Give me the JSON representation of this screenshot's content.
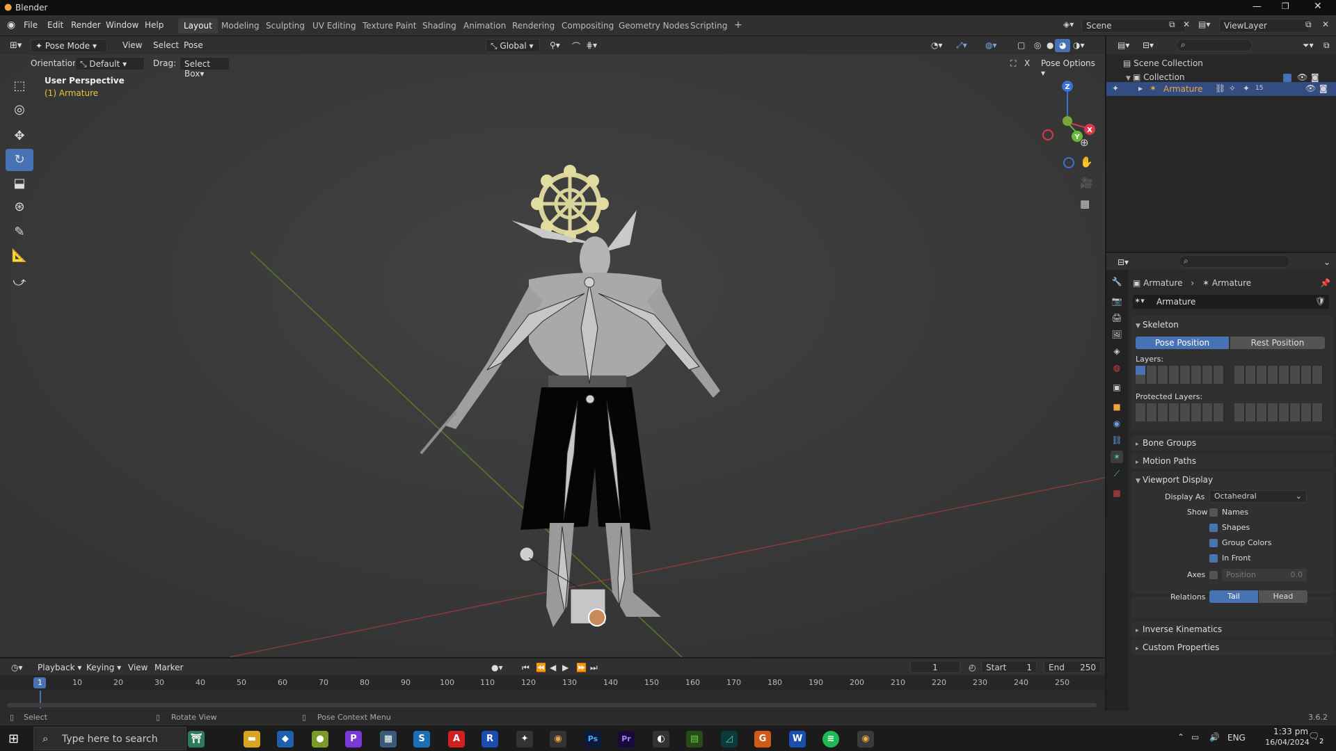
{
  "window": {
    "title": "Blender",
    "version": "3.6.2"
  },
  "menu": {
    "file": "File",
    "edit": "Edit",
    "render": "Render",
    "window": "Window",
    "help": "Help"
  },
  "workspaces": [
    "Layout",
    "Modeling",
    "Sculpting",
    "UV Editing",
    "Texture Paint",
    "Shading",
    "Animation",
    "Rendering",
    "Compositing",
    "Geometry Nodes",
    "Scripting"
  ],
  "active_workspace": "Layout",
  "scene": {
    "name": "Scene",
    "view_layer": "ViewLayer"
  },
  "viewport": {
    "mode": "Pose Mode",
    "menus": {
      "view": "View",
      "select": "Select",
      "pose": "Pose"
    },
    "transform_orientation": "Global",
    "orientation_label": "Orientation:",
    "orientation_value": "Default",
    "drag_label": "Drag:",
    "drag_value": "Select Box",
    "pose_options": "Pose Options",
    "overlay_title": "User Perspective",
    "overlay_object": "(1) Armature",
    "gizmo_axes": {
      "x": "X",
      "y": "Y",
      "z": "Z"
    }
  },
  "outliner": {
    "scene_collection": "Scene Collection",
    "collection": "Collection",
    "object": "Armature",
    "object_badge": "15"
  },
  "properties": {
    "breadcrumb_1": "Armature",
    "breadcrumb_2": "Armature",
    "data_name": "Armature",
    "skeleton": {
      "title": "Skeleton",
      "pose_position": "Pose Position",
      "rest_position": "Rest Position",
      "layers_label": "Layers:",
      "protected_label": "Protected Layers:"
    },
    "bone_groups": "Bone Groups",
    "motion_paths": "Motion Paths",
    "viewport_display": {
      "title": "Viewport Display",
      "display_as_label": "Display As",
      "display_as_value": "Octahedral",
      "show_label": "Show",
      "names": {
        "label": "Names",
        "checked": false
      },
      "shapes": {
        "label": "Shapes",
        "checked": true
      },
      "group_colors": {
        "label": "Group Colors",
        "checked": true
      },
      "in_front": {
        "label": "In Front",
        "checked": true
      },
      "axes_label": "Axes",
      "axes_position_label": "Position",
      "axes_position_value": "0.0",
      "relations_label": "Relations",
      "relations_tail": "Tail",
      "relations_head": "Head"
    },
    "inverse_kinematics": "Inverse Kinematics",
    "custom_properties": "Custom Properties"
  },
  "timeline": {
    "playback": "Playback",
    "keying": "Keying",
    "view": "View",
    "marker": "Marker",
    "current_frame": "1",
    "start_label": "Start",
    "start": "1",
    "end_label": "End",
    "end": "250",
    "ticks": [
      "1",
      "10",
      "20",
      "30",
      "40",
      "50",
      "60",
      "70",
      "80",
      "90",
      "100",
      "110",
      "120",
      "130",
      "140",
      "150",
      "160",
      "170",
      "180",
      "190",
      "200",
      "210",
      "220",
      "230",
      "240",
      "250"
    ]
  },
  "status": {
    "select": "Select",
    "rotate": "Rotate View",
    "context": "Pose Context Menu"
  },
  "taskbar": {
    "search_placeholder": "Type here to search",
    "lang": "ENG",
    "time": "1:33 pm",
    "date": "16/04/2024",
    "notifications": "2"
  },
  "colors": {
    "accent": "#4772b3",
    "active_object": "#f0a640",
    "overlay_object": "#e8c83c"
  }
}
